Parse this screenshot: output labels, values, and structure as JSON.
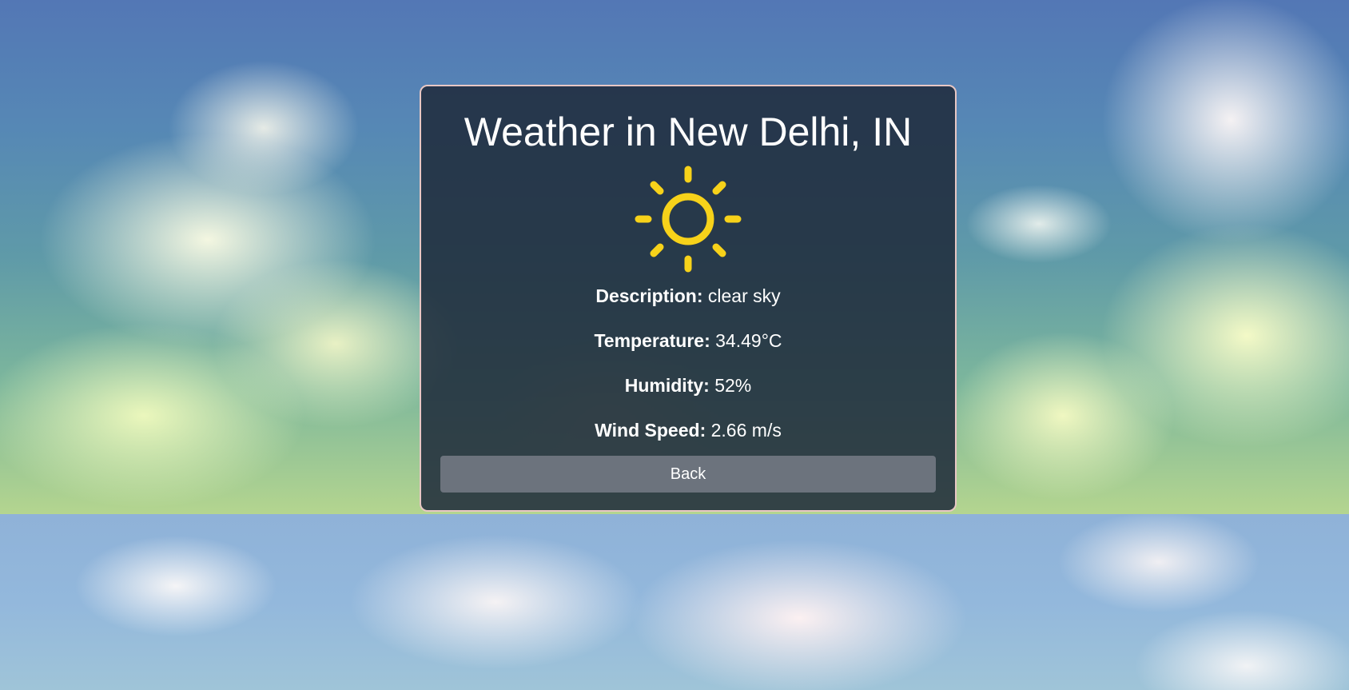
{
  "weather": {
    "title": "Weather in New Delhi, IN",
    "icon": "sun-icon",
    "icon_color": "#f7d21a",
    "description_label": "Description:",
    "description_value": "clear sky",
    "temperature_label": "Temperature:",
    "temperature_value": "34.49°C",
    "humidity_label": "Humidity:",
    "humidity_value": "52%",
    "wind_label": "Wind Speed:",
    "wind_value": "2.66 m/s",
    "back_label": "Back"
  },
  "colors": {
    "card_bg": "#1e2a3a",
    "card_border": "#e8c7c4",
    "button_bg": "#6c737d",
    "text": "#ffffff"
  }
}
